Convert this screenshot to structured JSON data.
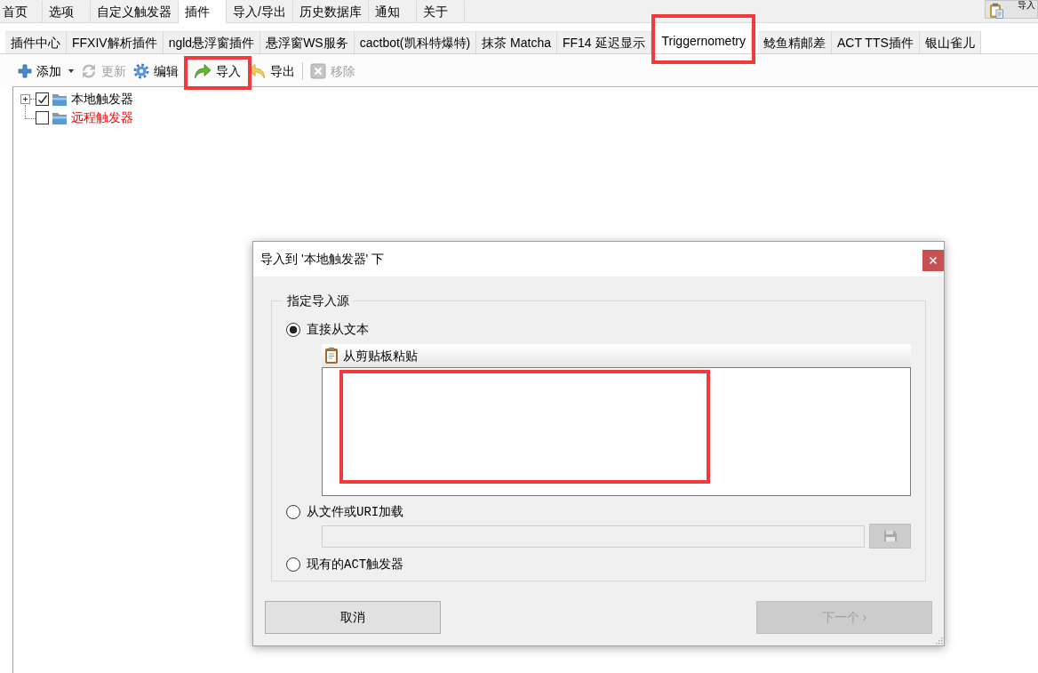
{
  "main_tabs": [
    {
      "label": "首页",
      "selected": false
    },
    {
      "label": "选项",
      "selected": false
    },
    {
      "label": "自定义触发器",
      "selected": false
    },
    {
      "label": "插件",
      "selected": true
    },
    {
      "label": "导入/导出",
      "selected": false
    },
    {
      "label": "历史数据库",
      "selected": false
    },
    {
      "label": "通知",
      "selected": false
    },
    {
      "label": "关于",
      "selected": false
    }
  ],
  "corner_button": {
    "label": "导入"
  },
  "plugin_tabs": [
    {
      "label": "插件中心",
      "selected": false,
      "highlighted": false
    },
    {
      "label": "FFXIV解析插件",
      "selected": false,
      "highlighted": false
    },
    {
      "label": "ngld悬浮窗插件",
      "selected": false,
      "highlighted": false
    },
    {
      "label": "悬浮窗WS服务",
      "selected": false,
      "highlighted": false
    },
    {
      "label": "cactbot(凯科特爆特)",
      "selected": false,
      "highlighted": false
    },
    {
      "label": "抹茶 Matcha",
      "selected": false,
      "highlighted": false
    },
    {
      "label": "FF14 延迟显示",
      "selected": false,
      "highlighted": false
    },
    {
      "label": "Triggernometry",
      "selected": true,
      "highlighted": true
    },
    {
      "label": "鲶鱼精邮差",
      "selected": false,
      "highlighted": false
    },
    {
      "label": "ACT TTS插件",
      "selected": false,
      "highlighted": false
    },
    {
      "label": "银山雀儿",
      "selected": false,
      "highlighted": false
    }
  ],
  "toolbar": [
    {
      "kind": "dropdown",
      "label": "添加",
      "disabled": false,
      "highlighted": false
    },
    {
      "kind": "button",
      "label": "更新",
      "disabled": true,
      "highlighted": false
    },
    {
      "kind": "button",
      "label": "编辑",
      "disabled": false,
      "highlighted": false
    },
    {
      "kind": "separator"
    },
    {
      "kind": "button",
      "label": "导入",
      "disabled": false,
      "highlighted": true
    },
    {
      "kind": "button",
      "label": "导出",
      "disabled": false,
      "highlighted": false
    },
    {
      "kind": "separator"
    },
    {
      "kind": "button",
      "label": "移除",
      "disabled": true,
      "highlighted": false
    }
  ],
  "tree": [
    {
      "label": "本地触发器",
      "checked": true,
      "expandable": true,
      "expanded": false
    },
    {
      "label": "远程触发器",
      "checked": false,
      "expandable": false,
      "color": "#ff0000"
    }
  ],
  "dialog": {
    "title": "导入到 '本地触发器' 下",
    "group_title": "指定导入源",
    "sources": [
      {
        "kind": "text",
        "label": "直接从文本",
        "selected": true,
        "paste_button": "从剪贴板粘贴",
        "text_area": {
          "highlighted": true
        }
      },
      {
        "kind": "file",
        "label": "从文件或URI加载",
        "selected": false,
        "path_field": {
          "disabled": true
        }
      },
      {
        "kind": "existing",
        "label": "现有的ACT触发器",
        "selected": false
      }
    ],
    "buttons": [
      {
        "label": "取消",
        "disabled": false
      },
      {
        "label": "下一个 ›",
        "disabled": true
      }
    ]
  }
}
